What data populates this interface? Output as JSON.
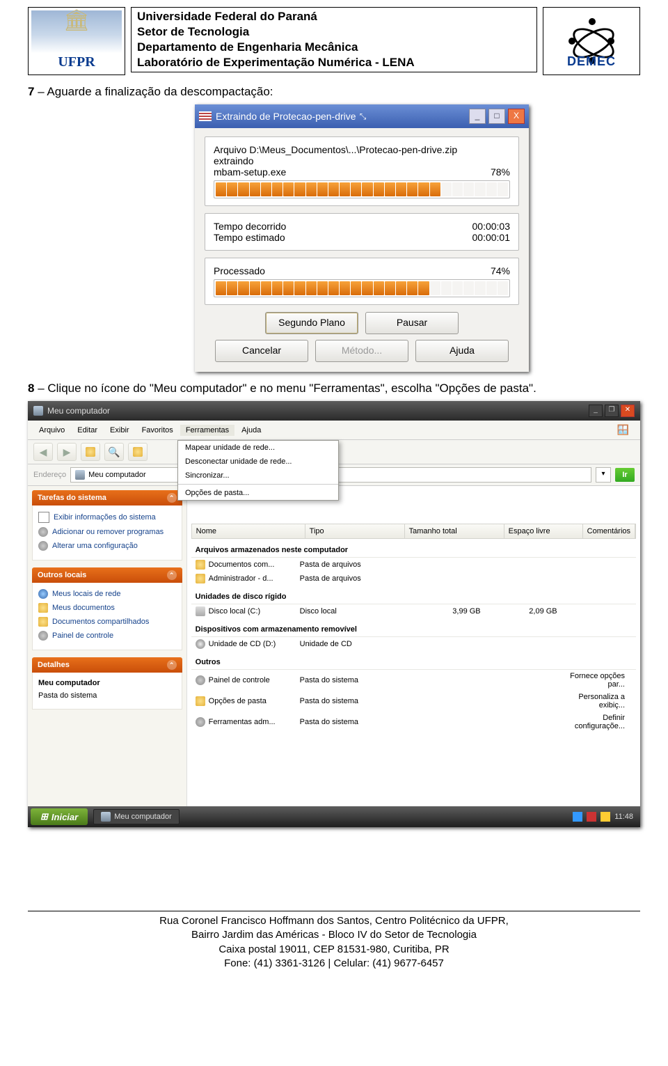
{
  "header": {
    "line1": "Universidade Federal do Paraná",
    "line2": "Setor de Tecnologia",
    "line3": "Departamento de Engenharia Mecânica",
    "line4": "Laboratório de Experimentação Numérica - LENA",
    "ufpr": "UFPR",
    "demec": "DEMEC"
  },
  "steps": {
    "s7_num": "7",
    "s7_txt": " – Aguarde a finalização da descompactação:",
    "s8_num": "8",
    "s8_txt": " – Clique no ícone do \"Meu computador\" e no menu \"Ferramentas\", escolha \"Opções de pasta\"."
  },
  "winrar": {
    "title": "Extraindo de Protecao-pen-drive",
    "min": "_",
    "max": "□",
    "close": "X",
    "arquivo_lbl": "Arquivo D:\\Meus_Documentos\\...\\Protecao-pen-drive.zip",
    "extraindo": "extraindo",
    "file": "mbam-setup.exe",
    "file_pct": "78%",
    "tempo_dec_lbl": "Tempo decorrido",
    "tempo_dec_val": "00:00:03",
    "tempo_est_lbl": "Tempo estimado",
    "tempo_est_val": "00:00:01",
    "proc_lbl": "Processado",
    "proc_pct": "74%",
    "bt_bg": "Segundo Plano",
    "bt_pause": "Pausar",
    "bt_cancel": "Cancelar",
    "bt_metodo": "Método...",
    "bt_ajuda": "Ajuda"
  },
  "explorer": {
    "title": "Meu computador",
    "menus": {
      "arquivo": "Arquivo",
      "editar": "Editar",
      "exibir": "Exibir",
      "favoritos": "Favoritos",
      "ferramentas": "Ferramentas",
      "ajuda": "Ajuda"
    },
    "dropdown": {
      "i1": "Mapear unidade de rede...",
      "i2": "Desconectar unidade de rede...",
      "i3": "Sincronizar...",
      "i4": "Opções de pasta..."
    },
    "addr_lbl": "Endereço",
    "addr_val": "Meu computador",
    "ir": "Ir",
    "cols": {
      "nome": "Nome",
      "tipo": "Tipo",
      "tam": "Tamanho total",
      "livre": "Espaço livre",
      "com": "Comentários"
    },
    "side": {
      "p1_title": "Tarefas do sistema",
      "p1_i1": "Exibir informações do sistema",
      "p1_i2": "Adicionar ou remover programas",
      "p1_i3": "Alterar uma configuração",
      "p2_title": "Outros locais",
      "p2_i1": "Meus locais de rede",
      "p2_i2": "Meus documentos",
      "p2_i3": "Documentos compartilhados",
      "p2_i4": "Painel de controle",
      "p3_title": "Detalhes",
      "p3_l1": "Meu computador",
      "p3_l2": "Pasta do sistema"
    },
    "grp1": "Arquivos armazenados neste computador",
    "r1_n": "Documentos com...",
    "r1_t": "Pasta de arquivos",
    "r2_n": "Administrador - d...",
    "r2_t": "Pasta de arquivos",
    "grp2": "Unidades de disco rígido",
    "r3_n": "Disco local (C:)",
    "r3_t": "Disco local",
    "r3_tam": "3,99 GB",
    "r3_liv": "2,09 GB",
    "grp3": "Dispositivos com armazenamento removível",
    "r4_n": "Unidade de CD (D:)",
    "r4_t": "Unidade de CD",
    "grp4": "Outros",
    "r5_n": "Painel de controle",
    "r5_t": "Pasta do sistema",
    "r5_c": "Fornece opções par...",
    "r6_n": "Opções de pasta",
    "r6_t": "Pasta do sistema",
    "r6_c": "Personaliza a exibiç...",
    "r7_n": "Ferramentas adm...",
    "r7_t": "Pasta do sistema",
    "r7_c": "Definir configuraçõe...",
    "start": "Iniciar",
    "task": "Meu computador",
    "clock": "11:48"
  },
  "footer": {
    "l1": "Rua Coronel Francisco Hoffmann dos Santos, Centro Politécnico da UFPR,",
    "l2": "Bairro Jardim das Américas - Bloco IV do Setor de Tecnologia",
    "l3": "Caixa postal 19011, CEP 81531-980, Curitiba, PR",
    "l4": "Fone: (41) 3361-3126 | Celular: (41) 9677-6457"
  }
}
